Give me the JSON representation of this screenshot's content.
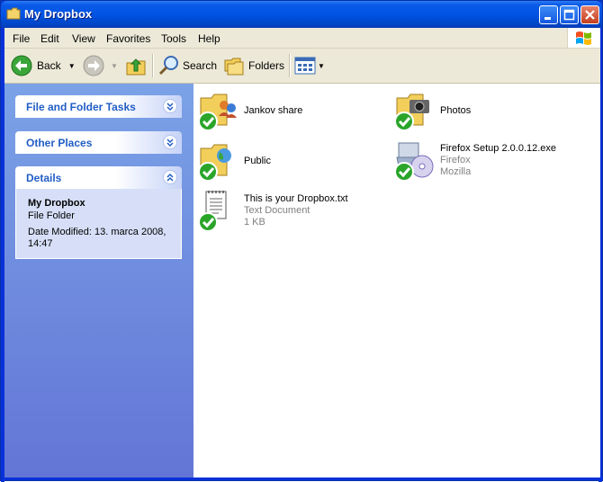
{
  "window": {
    "title": "My Dropbox"
  },
  "menu": [
    "File",
    "Edit",
    "View",
    "Favorites",
    "Tools",
    "Help"
  ],
  "toolbar": {
    "back_label": "Back",
    "search_label": "Search",
    "folders_label": "Folders"
  },
  "sidebar": {
    "file_tasks": "File and Folder Tasks",
    "other_places": "Other Places",
    "details": {
      "header": "Details",
      "name": "My Dropbox",
      "type": "File Folder",
      "modified": "Date Modified: 13. marca 2008, 14:47"
    }
  },
  "files": [
    {
      "name": "Jankov share",
      "icon": "shared-folder-icon"
    },
    {
      "name": "Photos",
      "icon": "camera-folder-icon"
    },
    {
      "name": "Public",
      "icon": "web-folder-icon"
    },
    {
      "name": "Firefox Setup 2.0.0.12.exe",
      "line2": "Firefox",
      "line3": "Mozilla",
      "icon": "installer-icon"
    },
    {
      "name": "This is your Dropbox.txt",
      "line2": "Text Document",
      "line3": "1 KB",
      "icon": "text-document-icon"
    }
  ],
  "colors": {
    "titlebar": "#0054e3",
    "sidebar_top": "#7ba2e7",
    "sidebar_bottom": "#6375d6",
    "panel_label": "#215dc6",
    "sync_check": "#2aa52a"
  }
}
